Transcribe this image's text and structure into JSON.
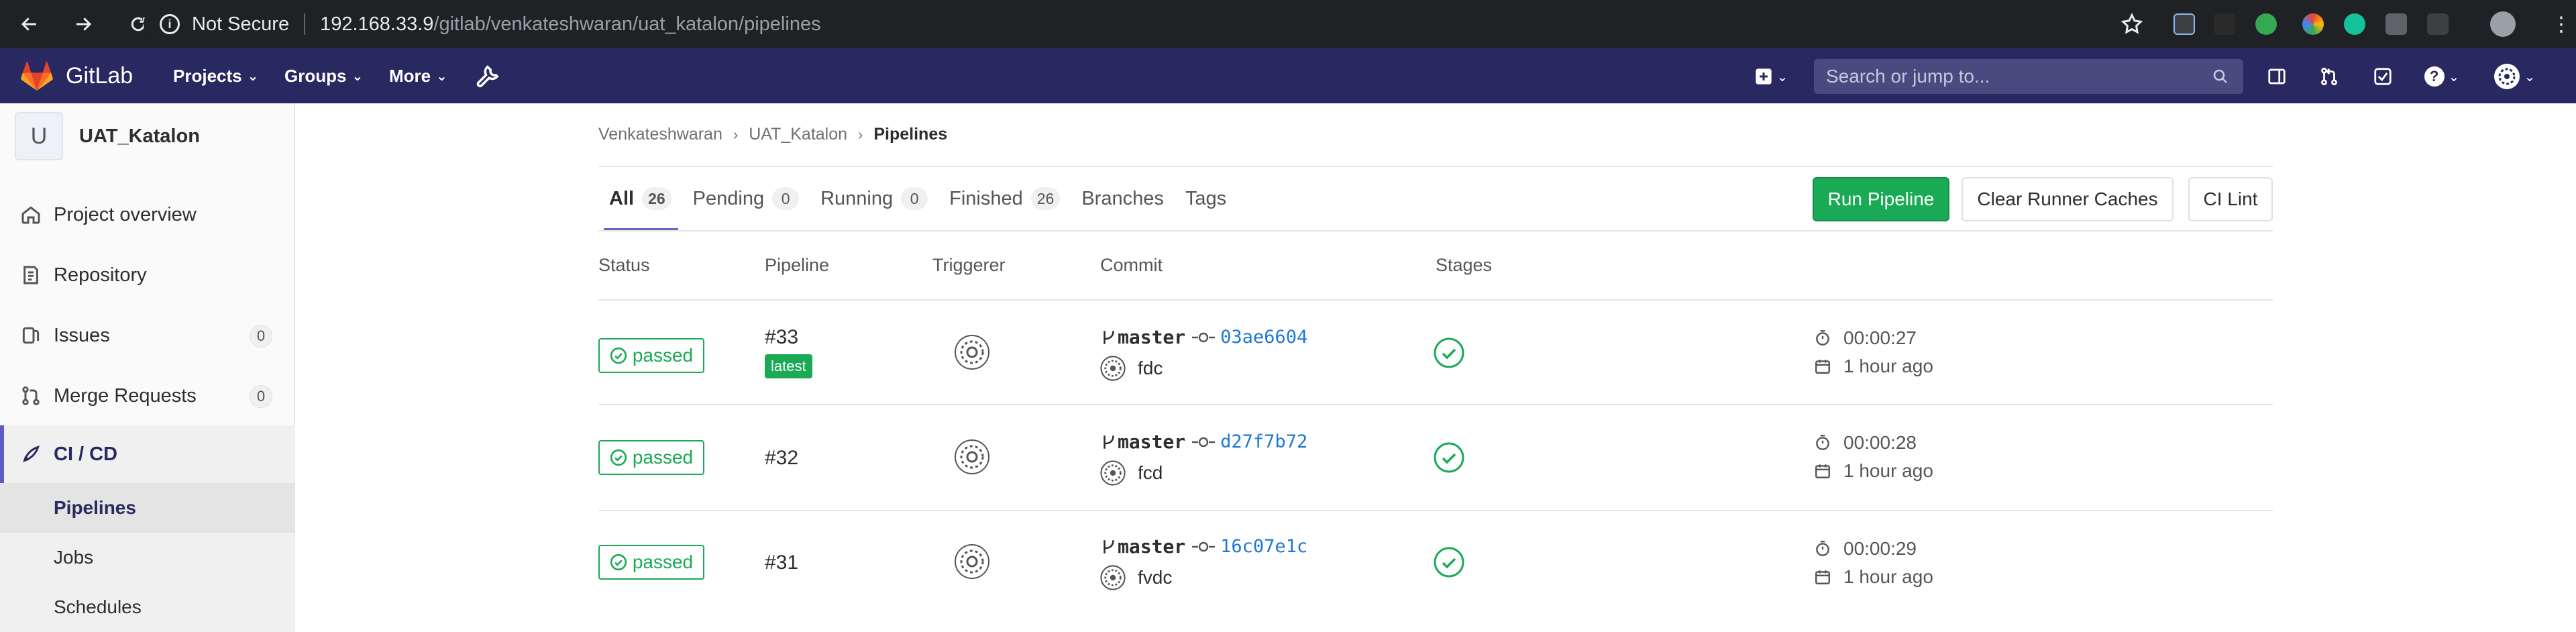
{
  "browser": {
    "security_label": "Not Secure",
    "url_host": "192.168.33.9",
    "url_path": "/gitlab/venkateshwaran/uat_katalon/pipelines"
  },
  "header": {
    "brand": "GitLab",
    "nav": [
      {
        "label": "Projects"
      },
      {
        "label": "Groups"
      },
      {
        "label": "More"
      }
    ],
    "search_placeholder": "Search or jump to..."
  },
  "sidebar": {
    "project_initial": "U",
    "project_name": "UAT_Katalon",
    "items": [
      {
        "label": "Project overview",
        "icon": "home-icon"
      },
      {
        "label": "Repository",
        "icon": "book-icon"
      },
      {
        "label": "Issues",
        "icon": "issues-icon",
        "count": "0"
      },
      {
        "label": "Merge Requests",
        "icon": "merge-request-icon",
        "count": "0"
      },
      {
        "label": "CI / CD",
        "icon": "rocket-icon"
      }
    ],
    "subitems": [
      {
        "label": "Pipelines"
      },
      {
        "label": "Jobs"
      },
      {
        "label": "Schedules"
      }
    ]
  },
  "breadcrumb": [
    "Venkateshwaran",
    "UAT_Katalon",
    "Pipelines"
  ],
  "tabs": [
    {
      "label": "All",
      "count": "26"
    },
    {
      "label": "Pending",
      "count": "0"
    },
    {
      "label": "Running",
      "count": "0"
    },
    {
      "label": "Finished",
      "count": "26"
    },
    {
      "label": "Branches"
    },
    {
      "label": "Tags"
    }
  ],
  "buttons": {
    "run_pipeline": "Run Pipeline",
    "clear_caches": "Clear Runner Caches",
    "ci_lint": "CI Lint"
  },
  "table": {
    "headers": [
      "Status",
      "Pipeline",
      "Triggerer",
      "Commit",
      "Stages"
    ],
    "rows": [
      {
        "status": "passed",
        "pipeline": "#33",
        "badge": "latest",
        "branch": "master",
        "sha": "03ae6604",
        "message": "fdc",
        "duration": "00:00:27",
        "finished": "1 hour ago"
      },
      {
        "status": "passed",
        "pipeline": "#32",
        "branch": "master",
        "sha": "d27f7b72",
        "message": "fcd",
        "duration": "00:00:28",
        "finished": "1 hour ago"
      },
      {
        "status": "passed",
        "pipeline": "#31",
        "branch": "master",
        "sha": "16c07e1c",
        "message": "fvdc",
        "duration": "00:00:29",
        "finished": "1 hour ago"
      }
    ]
  },
  "colors": {
    "header_bg": "#292961",
    "success": "#1aaa55",
    "link": "#1f78d1",
    "active_tab": "#6666c4"
  }
}
